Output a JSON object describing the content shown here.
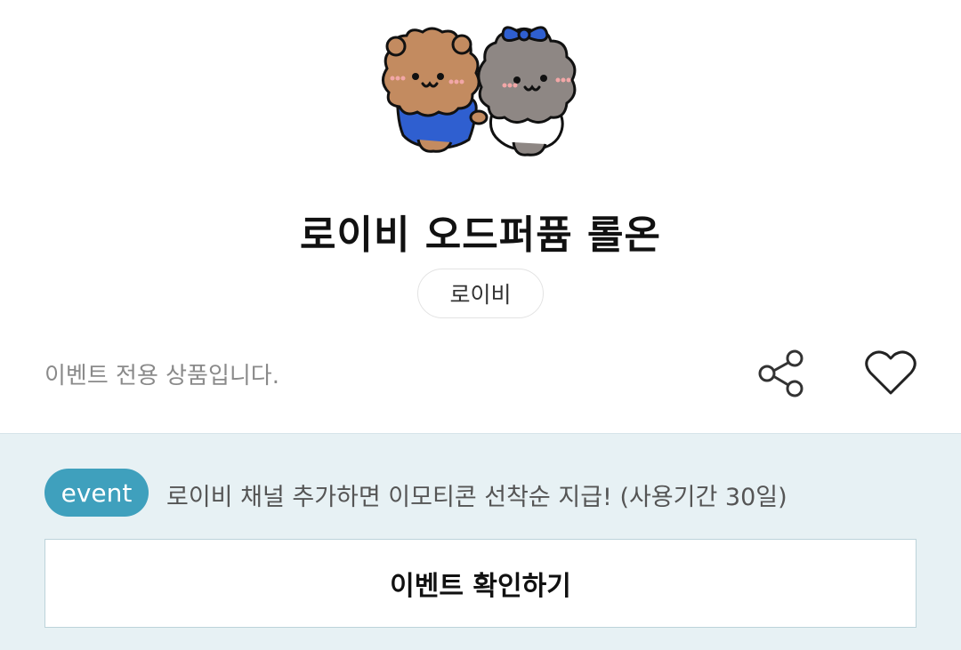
{
  "product": {
    "image_icon": "bear-and-poodle-characters-icon",
    "title": "로이비 오드퍼퓸 롤온",
    "author_chip": "로이비",
    "notice": "이벤트 전용 상품입니다."
  },
  "actions": {
    "share_icon": "share-icon",
    "like_icon": "heart-icon"
  },
  "event": {
    "badge": "event",
    "text": "로이비 채널 추가하면 이모티콘 선착순 지급! (사용기간 30일)",
    "button_label": "이벤트 확인하기"
  },
  "colors": {
    "event_panel_bg": "#e7f1f4",
    "badge_bg": "#3fa0bd",
    "bear_brown": "#c38b60",
    "poodle_gray": "#8e8784",
    "blue_outfit": "#2f5fd0"
  }
}
